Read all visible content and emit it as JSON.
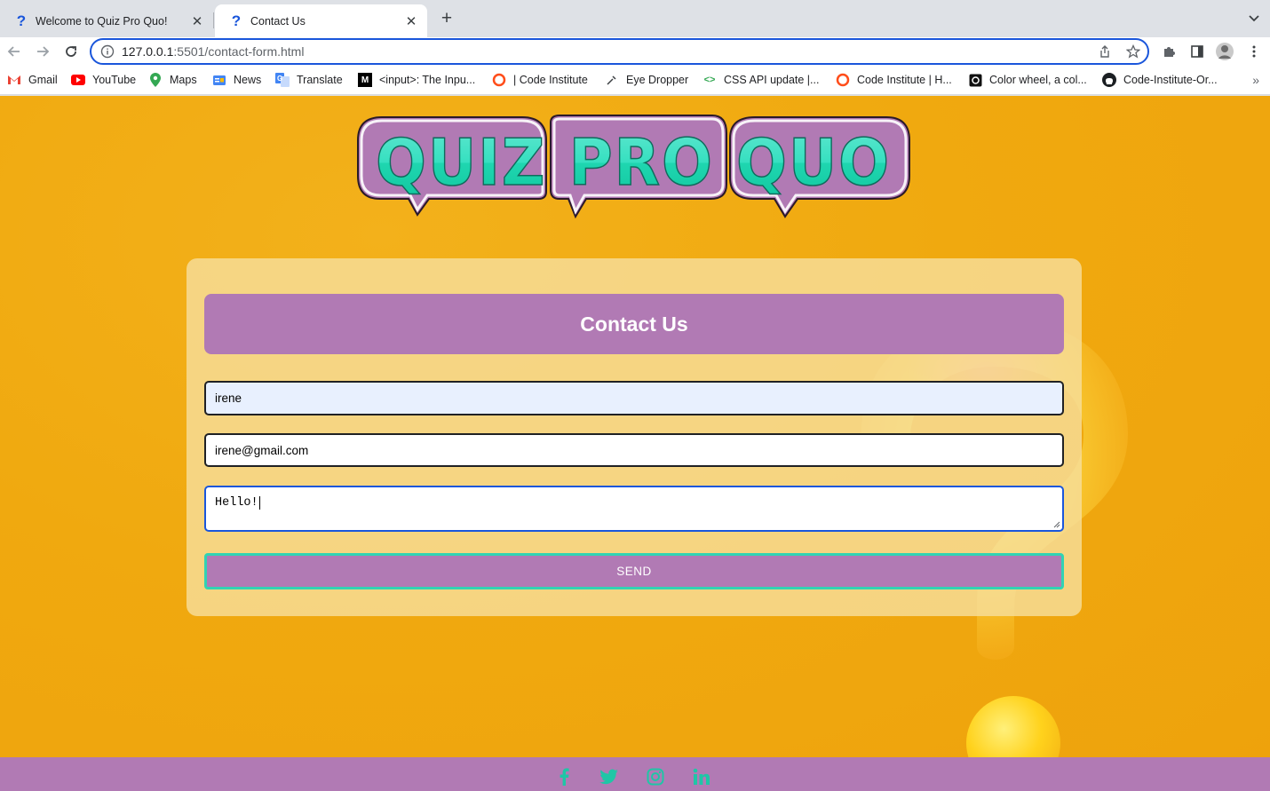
{
  "browser": {
    "tabs": [
      {
        "title": "Welcome to Quiz Pro Quo!",
        "active": false
      },
      {
        "title": "Contact Us",
        "active": true
      }
    ],
    "url_host": "127.0.0.1",
    "url_rest": ":5501/contact-form.html",
    "bookmarks": [
      {
        "label": "Gmail",
        "icon": "gmail-icon"
      },
      {
        "label": "YouTube",
        "icon": "youtube-icon"
      },
      {
        "label": "Maps",
        "icon": "maps-icon"
      },
      {
        "label": "News",
        "icon": "news-icon"
      },
      {
        "label": "Translate",
        "icon": "translate-icon"
      },
      {
        "label": "<input>: The Inpu...",
        "icon": "mdn-icon"
      },
      {
        "label": "| Code Institute",
        "icon": "code-institute-icon"
      },
      {
        "label": "Eye Dropper",
        "icon": "eyedropper-icon"
      },
      {
        "label": "CSS API update  |...",
        "icon": "code-brackets-icon"
      },
      {
        "label": "Code Institute | H...",
        "icon": "code-institute-icon"
      },
      {
        "label": "Color wheel, a col...",
        "icon": "color-wheel-icon"
      },
      {
        "label": "Code-Institute-Or...",
        "icon": "github-icon"
      }
    ]
  },
  "page": {
    "logo_text": "QUIZ PRO QUO",
    "form": {
      "heading": "Contact Us",
      "name_value": "irene",
      "email_value": "irene@gmail.com",
      "message_value": "Hello!",
      "send_label": "SEND"
    },
    "footer_icons": [
      "facebook-icon",
      "twitter-icon",
      "instagram-icon",
      "linkedin-icon"
    ]
  },
  "colors": {
    "page_bg": "#f0a90f",
    "accent_purple": "#b17ab4",
    "accent_teal": "#31d3b3",
    "card_bg": "#f7de9b"
  }
}
